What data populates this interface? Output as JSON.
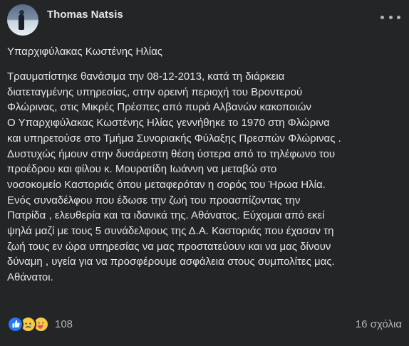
{
  "post": {
    "author": "Thomas Natsis",
    "title": "Υπαρχιφύλακας Κωστένης Ηλίας",
    "lines": [
      "Τραυματίστηκε θανάσιμα την 08-12-2013, κατά τη διάρκεια",
      "διατεταγμένης υπηρεσίας, στην ορεινή περιοχή του Βροντερού",
      "Φλώρινας, στις Μικρές Πρέσπες από πυρά Αλβανών κακοποιών",
      "Ο Υπαρχιφύλακας Κωστένης Ηλίας γεννήθηκε το 1970 στη Φλώρινα",
      "και υπηρετούσε στο Τμήμα Συνοριακής Φύλαξης Πρεσπών Φλώρινας .",
      "Δυστυχώς ήμουν στην δυσάρεστη θέση ύστερα από το τηλέφωνο του",
      "προέδρου και φίλου  κ. Μουρατίδη Ιωάννη να μεταβώ στο",
      "νοσοκομείο  Καστοριάς  όπου μεταφερόταν η σορός του Ήρωα Ηλία.",
      "Ενός συναδέλφου που έδωσε την ζωή του προασπίζοντας την",
      "Πατρίδα , ελευθερία και τα ιδανικά της. Αθάνατος.  Εύχομαι από εκεί",
      "ψηλά μαζί με τους 5 συνάδελφους της Δ.Α.  Καστοριάς που έχασαν τη",
      "ζωή τους εν ώρα υπηρεσίας να μας προστατεύουν και να μας δίνουν",
      "δύναμη , υγεία για να προσφέρουμε ασφάλεια στους συμπολίτες μας.",
      "Αθάνατοι."
    ]
  },
  "footer": {
    "reaction_icons": [
      "like-icon",
      "sad-icon",
      "care-icon"
    ],
    "reaction_count": "108",
    "comments": "16 σχόλια"
  },
  "colors": {
    "background": "#242526",
    "text": "#e4e6eb",
    "secondary_text": "#b0b3b8",
    "like_blue": "#2078f4",
    "emoji_yellow": "#f7c94a"
  }
}
